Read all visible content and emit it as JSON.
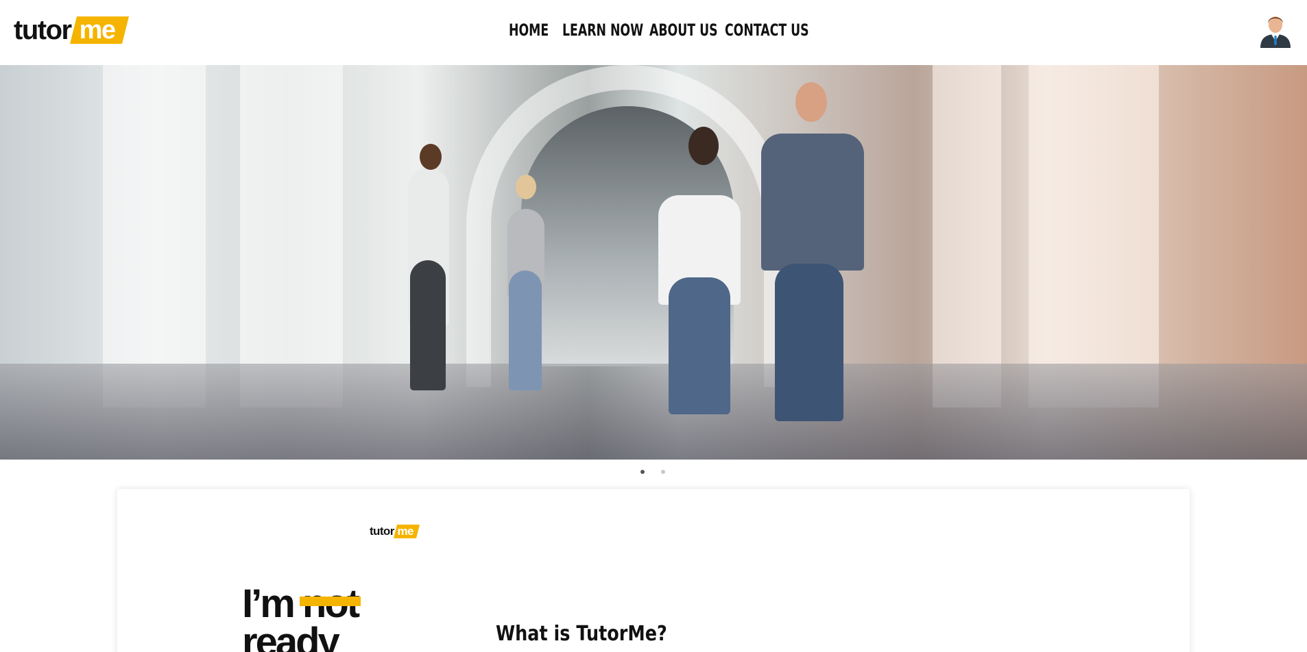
{
  "brand": {
    "logo_text": "tutor",
    "logo_accent_text": "me",
    "accent_color": "#F5B400"
  },
  "nav": {
    "items": [
      {
        "label": "HOME"
      },
      {
        "label": "LEARN NOW"
      },
      {
        "label": "ABOUT US"
      },
      {
        "label": "CONTACT US"
      }
    ]
  },
  "user": {
    "avatar_icon": "user-avatar-icon"
  },
  "hero": {
    "image_subject": "students-walking-in-hallway-photo",
    "carousel": {
      "slides": 2,
      "active_index": 0,
      "active_color": "#555555",
      "inactive_color": "#C8C8C8"
    }
  },
  "intro": {
    "card_logo_text": "tutor",
    "card_logo_accent_text": "me",
    "slogan_part1": "I’m ",
    "slogan_strike": "not",
    "slogan_part2": "ready",
    "heading": "What is TutorMe?"
  }
}
